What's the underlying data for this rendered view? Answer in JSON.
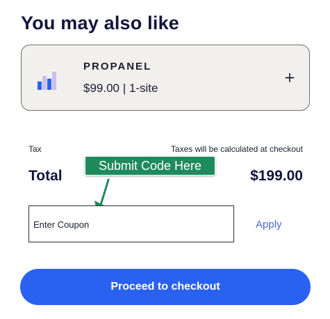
{
  "upsell": {
    "title": "You may also like",
    "product": {
      "name": "PROPANEL",
      "price_text": "$99.00 | 1-site",
      "icon": "bar-chart-icon",
      "add_symbol": "+"
    }
  },
  "summary": {
    "tax_label": "Tax",
    "tax_value": "Taxes will be calculated at checkout",
    "total_label": "Total",
    "total_value": "$199.00"
  },
  "annotation": {
    "callout_text": "Submit Code Here"
  },
  "coupon": {
    "placeholder": "Enter Coupon",
    "apply_label": "Apply"
  },
  "checkout": {
    "button_label": "Proceed to checkout"
  },
  "colors": {
    "accent": "#2961f0",
    "card_bg": "#f2f0ed",
    "callout": "#1f8a5b",
    "link": "#4b6ad6"
  }
}
